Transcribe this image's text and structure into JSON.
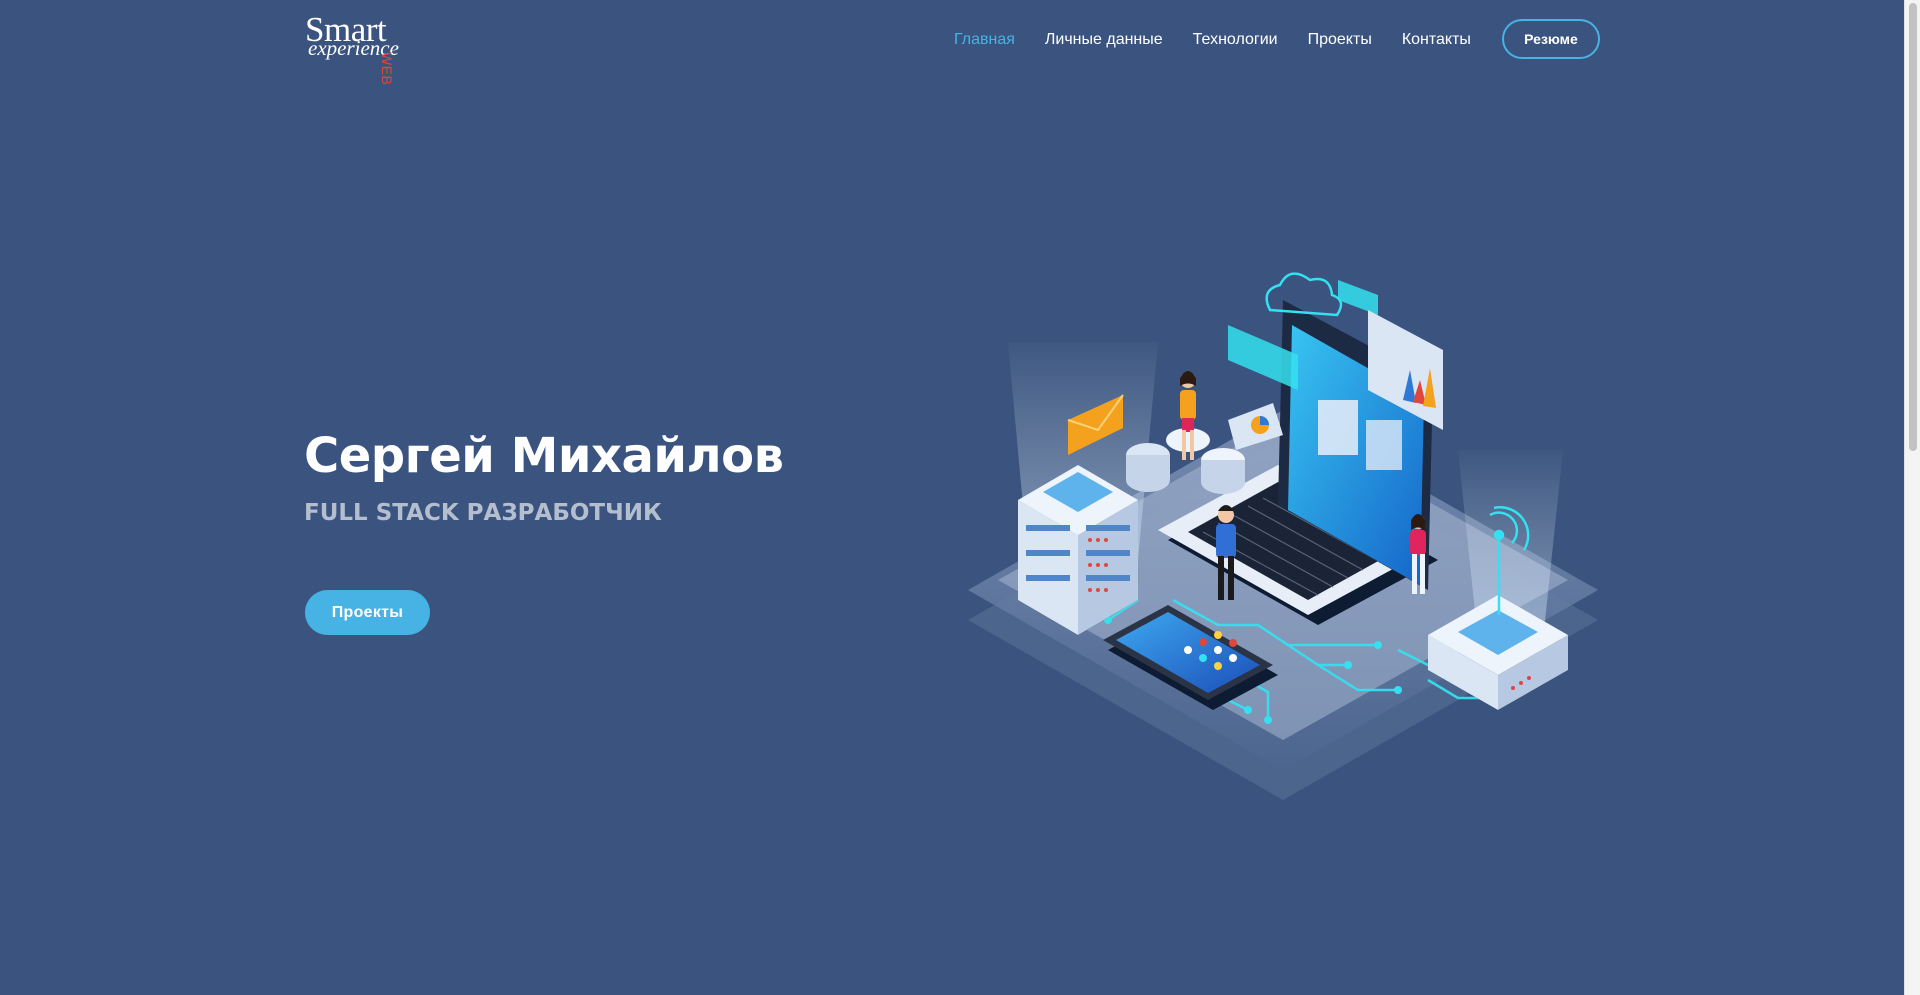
{
  "header": {
    "logo": {
      "line1": "Smart",
      "line2": "experience",
      "accent": "WEB"
    },
    "nav": [
      {
        "label": "Главная",
        "active": true
      },
      {
        "label": "Личные данные",
        "active": false
      },
      {
        "label": "Технологии",
        "active": false
      },
      {
        "label": "Проекты",
        "active": false
      },
      {
        "label": "Контакты",
        "active": false
      }
    ],
    "resume_label": "Резюме"
  },
  "hero": {
    "name": "Сергей Михайлов",
    "role": "FULL STACK РАЗРАБОТЧИК",
    "cta_label": "Проекты"
  },
  "colors": {
    "background": "#3a547f",
    "accent": "#47b2e4",
    "logo_accent": "#e0463b"
  }
}
